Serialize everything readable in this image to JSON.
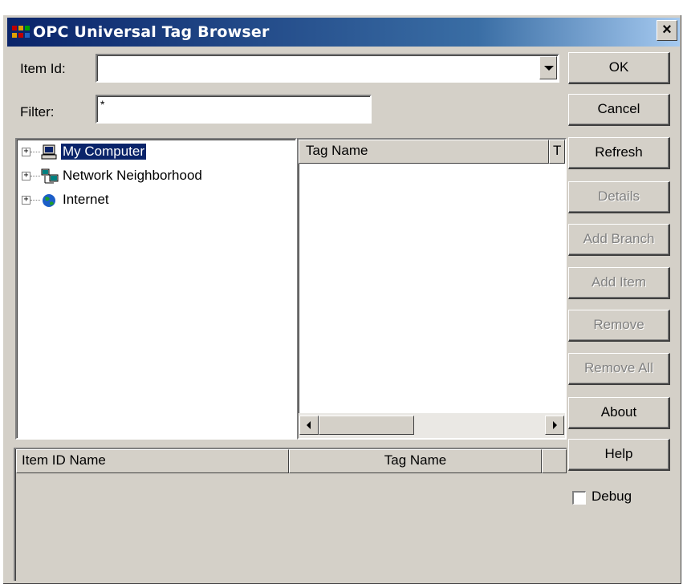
{
  "window": {
    "title": "OPC Universal Tag Browser",
    "close_glyph": "×"
  },
  "form": {
    "item_id_label": "Item Id:",
    "item_id_value": "",
    "filter_label": "Filter:",
    "filter_value": "*"
  },
  "tree": {
    "items": [
      {
        "label": "My Computer",
        "icon": "computer-icon",
        "selected": true
      },
      {
        "label": "Network Neighborhood",
        "icon": "network-icon",
        "selected": false
      },
      {
        "label": "Internet",
        "icon": "globe-icon",
        "selected": false
      }
    ],
    "expander_glyph": "+"
  },
  "tag_list": {
    "col1": "Tag Name",
    "col2": "T"
  },
  "item_list": {
    "col1": "Item ID Name",
    "col2": "Tag Name"
  },
  "buttons": {
    "ok": "OK",
    "cancel": "Cancel",
    "refresh": "Refresh",
    "details": "Details",
    "add_branch": "Add Branch",
    "add_item": "Add Item",
    "remove": "Remove",
    "remove_all": "Remove All",
    "about": "About",
    "help": "Help"
  },
  "debug": {
    "label": "Debug",
    "checked": false
  },
  "colors": {
    "title_active": "#0a246a",
    "face": "#d4d0c8",
    "selection": "#0a246a"
  }
}
